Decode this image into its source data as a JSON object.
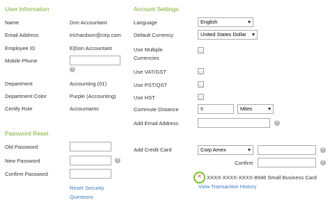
{
  "user_info": {
    "heading": "User Information",
    "fields": [
      {
        "label": "Name",
        "value": "Don Accountant"
      },
      {
        "label": "Email Address",
        "value": "trichardson@cirp.com"
      },
      {
        "label": "Employee ID",
        "value": "E|Don Accountant"
      },
      {
        "label": "Mobile Phone",
        "value": ""
      },
      {
        "label": "Department",
        "value": "Accounting (01)"
      },
      {
        "label": "Department Color",
        "value": "Purple (Accounting)"
      },
      {
        "label": "Certify Role",
        "value": "Accountants"
      }
    ]
  },
  "password_reset": {
    "heading": "Password Reset",
    "old_label": "Old Password",
    "new_label": "New Password",
    "confirm_label": "Confirm Password",
    "reset_link_line1": "Reset Security",
    "reset_link_line2": "Questions"
  },
  "account_settings": {
    "heading": "Account Settings",
    "language_label": "Language",
    "language_value": "English",
    "currency_label": "Default Currency",
    "currency_value": "United States Dollar",
    "multi_currency_label_1": "Use Multiple",
    "multi_currency_label_2": "Currencies",
    "vat_label": "Use VAT/GST",
    "pst_label": "Use PST/QST",
    "hst_label": "Use HST",
    "commute_label": "Commute Distance",
    "commute_value": "6",
    "commute_unit": "Miles",
    "add_email_label": "Add Email Address",
    "add_card_label": "Add Credit Card",
    "card_type": "Corp Amex",
    "confirm_label": "Confirm",
    "saved_card": "XXXX-XXXX-XXXX-8946 Small Business Card",
    "history_link": "View Transaction History"
  },
  "icons": {
    "help": "?",
    "remove": "×"
  },
  "colors": {
    "heading": "#7bab2e",
    "link": "#3a7bbf",
    "remove_ring": "#7bbd23",
    "remove_x": "#d9534f"
  }
}
